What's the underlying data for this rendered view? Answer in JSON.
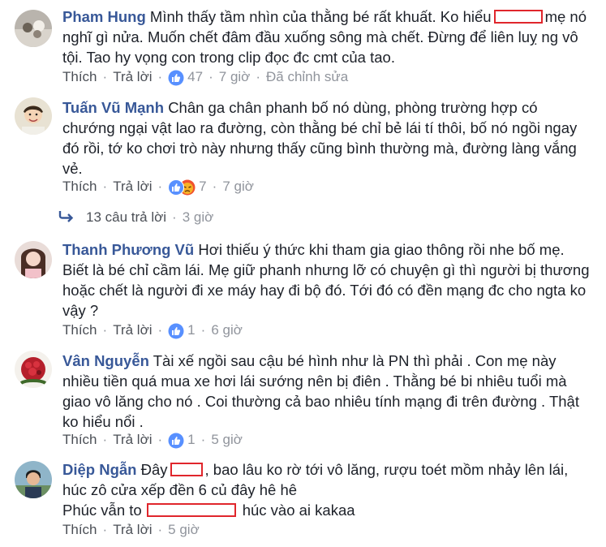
{
  "labels": {
    "like": "Thích",
    "reply": "Trả lời",
    "edited": "Đã chỉnh sửa",
    "dot": "·"
  },
  "colors": {
    "name": "#385898",
    "redaction": "#e0262c",
    "meta": "#90949c",
    "like_blue": "#5890ff",
    "angry": "#f0512e"
  },
  "comments": [
    {
      "name": "Pham Hung",
      "parts": [
        "Mình thấy tầm nhìn của thằng bé rất khuất. Ko hiểu",
        "mẹ nó nghĩ gì nửa. Muốn chết đâm đầu xuống sông mà chết. Đừng để liên luỵ ng vô tội. Tao hy vọng con trong clip đọc đc cmt của tao."
      ],
      "reactions": [
        "like-icon"
      ],
      "reaction_count": "47",
      "time": "7 giờ",
      "edited": true
    },
    {
      "name": "Tuấn Vũ Mạnh",
      "parts": [
        "Chân ga chân phanh bố nó dùng, phòng trường hợp có chướng ngại vật lao ra đường, còn thằng bé chỉ bẻ lái tí thôi, bố nó ngồi ngay đó rồi, tớ ko chơi trò này nhưng thấy cũng bình thường mà, đường làng vắng vẻ."
      ],
      "reactions": [
        "like-icon",
        "angry-icon"
      ],
      "reaction_count": "7",
      "time": "7 giờ"
    },
    {
      "name": "Thanh Phương Vũ",
      "parts": [
        "Hơi thiếu ý thức khi tham gia giao thông rồi nhe bố mẹ. Biết là bé chỉ cầm lái. Mẹ giữ phanh nhưng lỡ có chuyện gì thì người bị thương hoặc chết là người đi xe máy hay đi bộ đó. Tới đó có đền mạng đc cho ngta ko vậy ?"
      ],
      "reactions": [
        "like-icon"
      ],
      "reaction_count": "1",
      "time": "6 giờ"
    },
    {
      "name": "Vân Nguyễn",
      "parts": [
        "Tài xế ngồi sau cậu bé hình như là PN thì phải . Con mẹ này nhiều tiền quá mua xe hơi lái sướng nên bị điên . Thằng bé bi nhiêu tuổi mà giao vô lăng cho nó . Coi thường cả bao nhiêu tính mạng đi trên đường . Thật ko hiểu nổi ."
      ],
      "reactions": [
        "like-icon"
      ],
      "reaction_count": "1",
      "time": "5 giờ"
    },
    {
      "name": "Diệp Ngẫn",
      "parts": [
        "Đây",
        ", bao lâu ko rờ tới vô lăng, rượu toét mồm nhảy lên lái, húc zô cửa xếp đền 6 củ đây hê hê",
        "Phúc vẫn to",
        "húc vào ai kakaa"
      ],
      "time": "5 giờ"
    }
  ],
  "replies": {
    "icon": "reply-arrow-icon",
    "count_label": "13 câu trả lời",
    "time": "3 giờ"
  }
}
